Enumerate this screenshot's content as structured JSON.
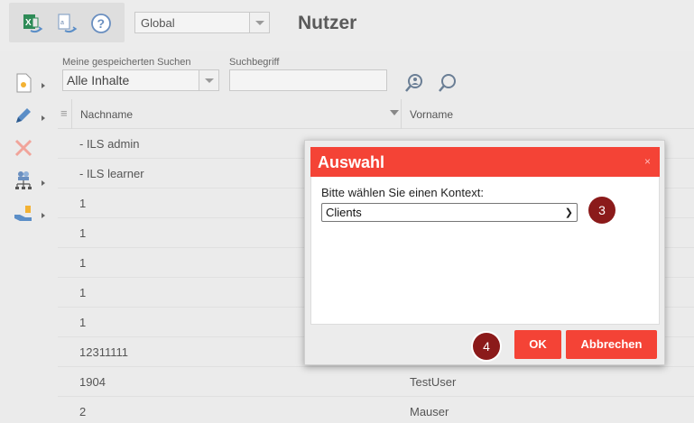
{
  "header": {
    "title": "Nutzer",
    "scope_value": "Global",
    "icons": [
      "excel-export-icon",
      "report-export-icon",
      "help-icon"
    ]
  },
  "search": {
    "saved_label": "Meine gespeicherten Suchen",
    "saved_value": "Alle Inhalte",
    "term_label": "Suchbegriff",
    "term_value": ""
  },
  "left_tools": [
    "new-item-icon",
    "edit-icon",
    "delete-icon",
    "user-hierarchy-icon",
    "assign-icon"
  ],
  "table": {
    "columns": [
      "Nachname",
      "Vorname"
    ],
    "rows": [
      {
        "nachname": "- ILS admin",
        "vorname": ""
      },
      {
        "nachname": "- ILS learner",
        "vorname": ""
      },
      {
        "nachname": "1",
        "vorname": ""
      },
      {
        "nachname": "1",
        "vorname": ""
      },
      {
        "nachname": "1",
        "vorname": ""
      },
      {
        "nachname": "1",
        "vorname": ""
      },
      {
        "nachname": "1",
        "vorname": ""
      },
      {
        "nachname": "12311111",
        "vorname": ""
      },
      {
        "nachname": "1904",
        "vorname": "TestUser"
      },
      {
        "nachname": "2",
        "vorname": "Mauser"
      }
    ]
  },
  "modal": {
    "title": "Auswahl",
    "close": "×",
    "prompt": "Bitte wählen Sie einen Kontext:",
    "context_value": "Clients",
    "ok_label": "OK",
    "cancel_label": "Abbrechen",
    "badge_select": "3",
    "badge_buttons": "4"
  },
  "colors": {
    "accent": "#f44336",
    "badge": "#8b1a1a",
    "background": "#ebebeb"
  }
}
